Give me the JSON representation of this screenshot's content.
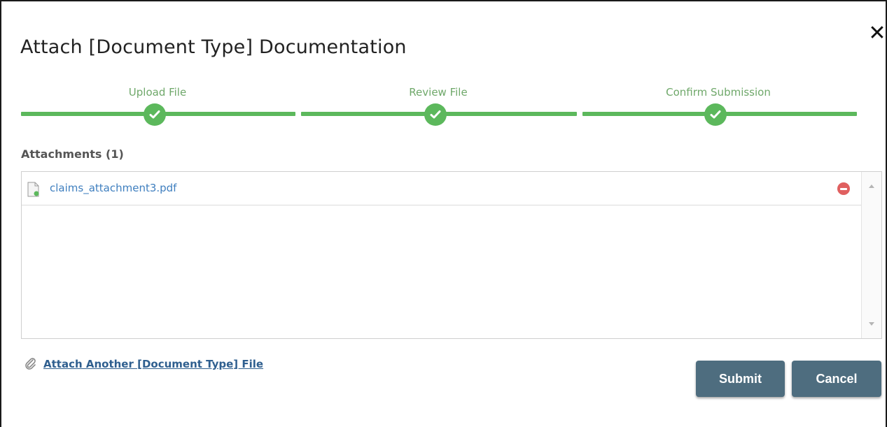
{
  "dialog": {
    "title": "Attach [Document Type] Documentation",
    "close_symbol": "✕"
  },
  "stepper": {
    "steps": [
      {
        "label": "Upload File",
        "status": "complete"
      },
      {
        "label": "Review File",
        "status": "complete"
      },
      {
        "label": "Confirm Submission",
        "status": "complete"
      }
    ],
    "complete_color": "#5cb85c"
  },
  "attachments": {
    "heading": "Attachments (1)",
    "files": [
      {
        "name": "claims_attachment3.pdf",
        "icon": "document-icon",
        "remove_icon": "remove-circle-icon"
      }
    ]
  },
  "footer": {
    "attach_another_label": "Attach Another [Document Type] File",
    "attach_another_icon": "paperclip-icon",
    "submit_label": "Submit",
    "cancel_label": "Cancel",
    "button_color": "#4e6d7f"
  }
}
